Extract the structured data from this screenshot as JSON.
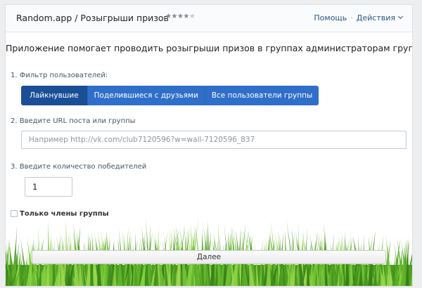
{
  "header": {
    "title": "Random.app / Розыгрыши призов",
    "rating": {
      "value": 4,
      "max": 5
    },
    "help_link": "Помощь",
    "actions_link": "Действия"
  },
  "main": {
    "description": "Приложение помогает проводить розыгрыши призов в группах администраторам групп.",
    "step1": {
      "label": "1. Фильтр пользователей:",
      "options": [
        "Лайкнувшие",
        "Поделившиеся с друзьями",
        "Все пользователи группы"
      ],
      "selected": "Лайкнувшие"
    },
    "step2": {
      "label": "2. Введите URL поста или группы",
      "placeholder": "Например http://vk.com/club7120596?w=wall-7120596_837",
      "value": ""
    },
    "step3": {
      "label": "3. Введите количество победителей",
      "value": "1"
    },
    "members_only": {
      "label": "Только члены группы",
      "checked": false
    },
    "next_button": "Далее"
  },
  "colors": {
    "accent": "#2f6fc9",
    "accent_active": "#1a4f96",
    "link": "#2a5885",
    "grass": "#5fb02a"
  },
  "icons": {
    "rating": "star-icon",
    "actions_dropdown": "chevron-down-icon",
    "background": "grass-image"
  }
}
